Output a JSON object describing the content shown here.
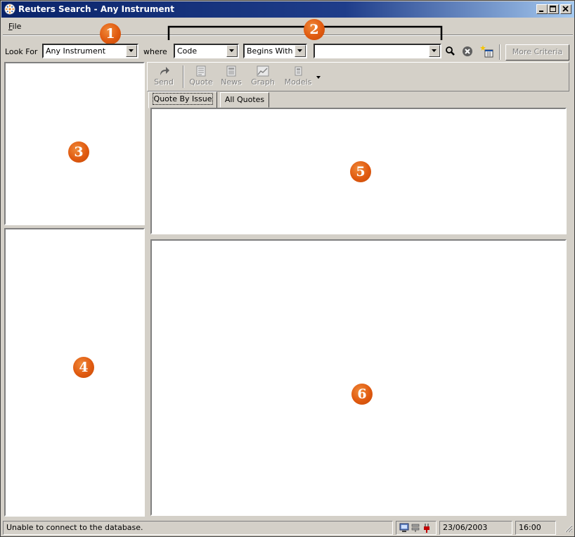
{
  "window": {
    "title": "Reuters Search - Any Instrument",
    "minimize": "_",
    "maximize": "□",
    "close": "×"
  },
  "menu": {
    "file": "File"
  },
  "criteria": {
    "look_for_label": "Look For",
    "look_for_value": "Any Instrument",
    "where_label": "where",
    "field_value": "Code",
    "operator_value": "Begins With",
    "search_value": "",
    "more_criteria_label": "More Criteria"
  },
  "toolbar": {
    "send": "Send",
    "quote": "Quote",
    "news": "News",
    "graph": "Graph",
    "models": "Models"
  },
  "tabs": [
    {
      "label": "Quote By Issue",
      "active": true
    },
    {
      "label": "All Quotes",
      "active": false
    }
  ],
  "callouts": [
    "1",
    "2",
    "3",
    "4",
    "5",
    "6"
  ],
  "status": {
    "message": "Unable to connect to the database.",
    "date": "23/06/2003",
    "time": "16:00"
  },
  "colors": {
    "callout": "#e05a10",
    "titlebar": "#0a246a"
  }
}
